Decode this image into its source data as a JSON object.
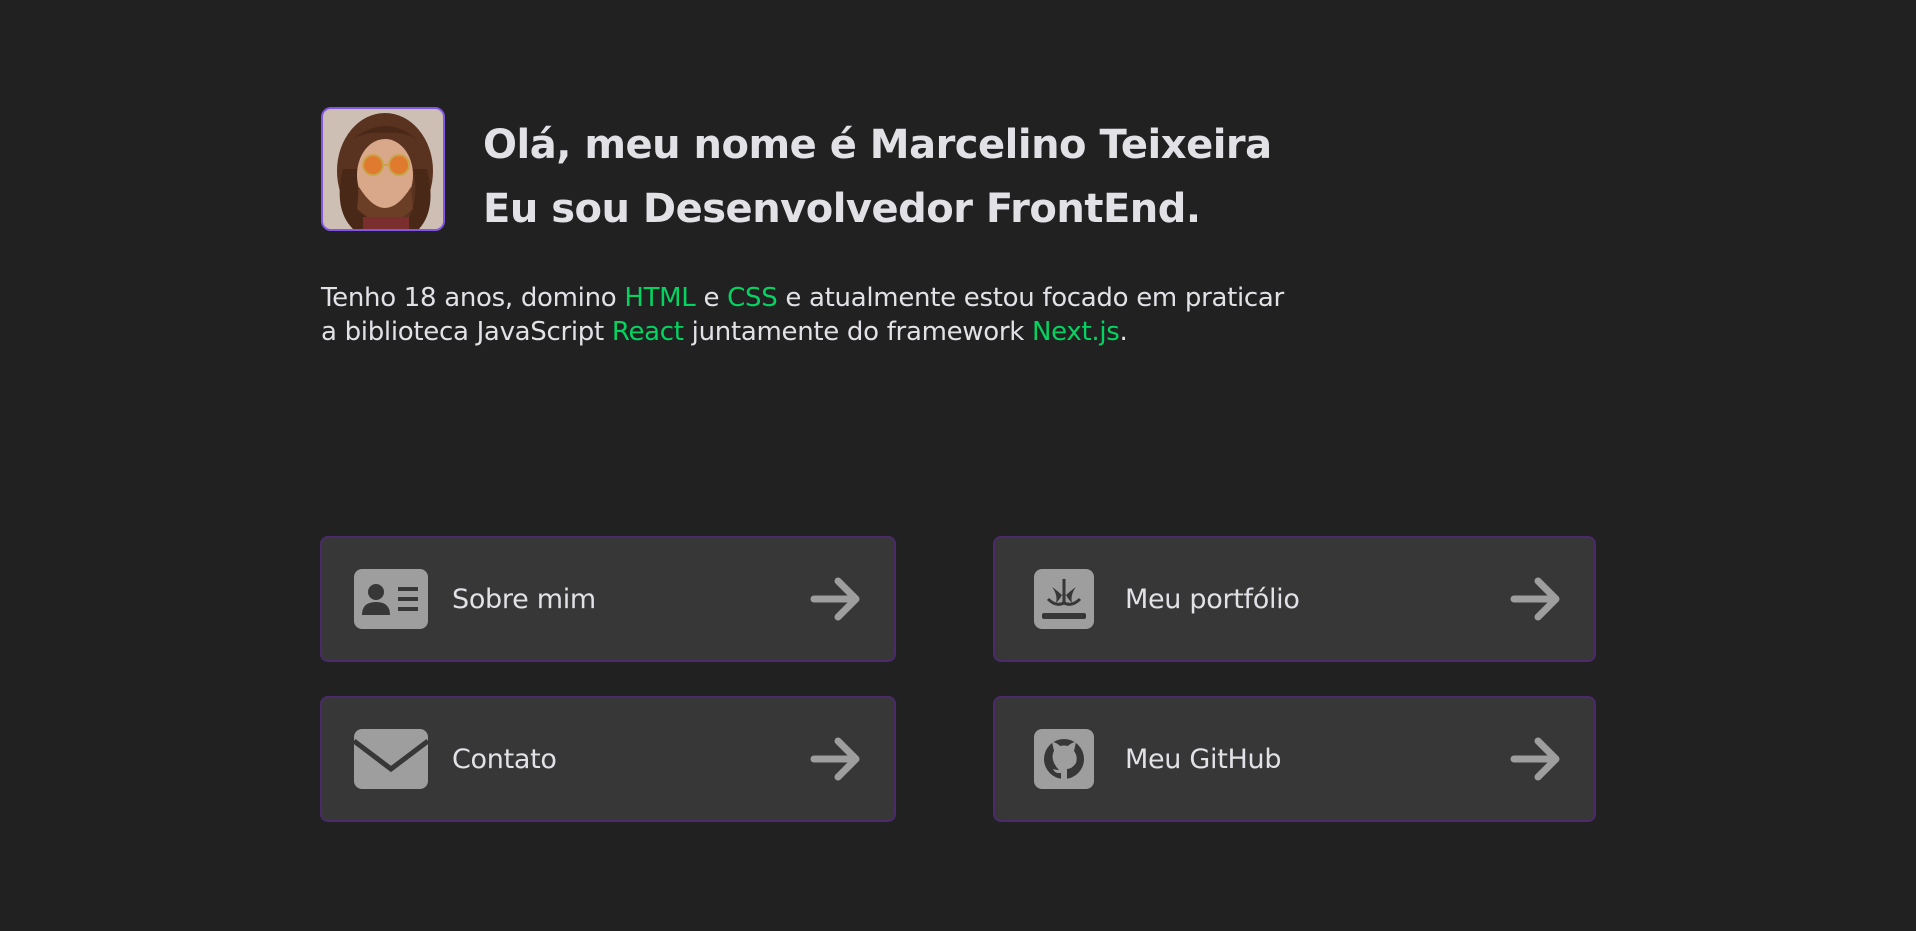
{
  "profile": {
    "greeting": "Olá, meu nome é Marcelino Teixeira",
    "role": "Eu sou Desenvolvedor FrontEnd.",
    "avatar_alt": "avatar"
  },
  "bio": {
    "part1": "Tenho 18 anos, domino ",
    "html": "HTML",
    "part2": " e ",
    "css": "CSS",
    "part3": " e atualmente estou focado em praticar a biblioteca JavaScript ",
    "react": "React",
    "part4": " juntamente do framework ",
    "next": "Next.js",
    "part5": "."
  },
  "links": {
    "about": {
      "label": "Sobre mim",
      "icon": "id-card-icon"
    },
    "portfolio": {
      "label": "Meu portfólio",
      "icon": "book-icon"
    },
    "contact": {
      "label": "Contato",
      "icon": "envelope-icon"
    },
    "github": {
      "label": "Meu GitHub",
      "icon": "github-icon"
    }
  },
  "colors": {
    "background": "#212121",
    "card": "#373737",
    "card_border": "#4a2a6b",
    "accent_green": "#04d361",
    "text": "#e1e1e6",
    "icon": "#9e9e9e"
  }
}
